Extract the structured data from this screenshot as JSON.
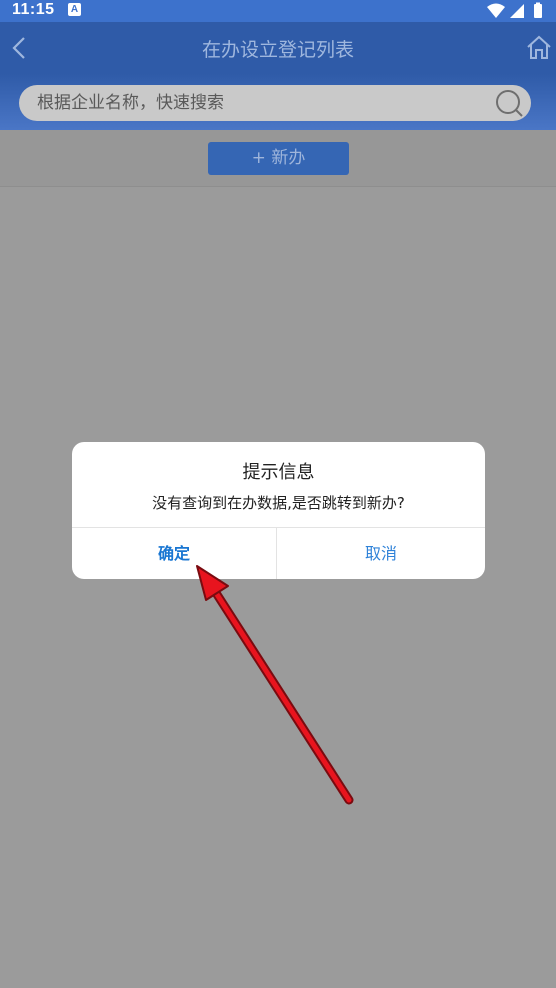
{
  "status_bar": {
    "time": "11:15",
    "notification_glyph": "A"
  },
  "header": {
    "title": "在办设立登记列表",
    "back_icon": "back-icon",
    "home_icon": "home-icon"
  },
  "search": {
    "placeholder": "根据企业名称，快速搜索"
  },
  "toolbar": {
    "new_label": "+ 新办"
  },
  "dialog": {
    "title": "提示信息",
    "message": "没有查询到在办数据,是否跳转到新办?",
    "confirm_label": "确定",
    "cancel_label": "取消"
  },
  "colors": {
    "header": "#2f5ba8",
    "status": "#3d72cc",
    "overlay": "#9b9b9b",
    "arrow": "#e8141e",
    "dialog_button": "#1976d2"
  }
}
